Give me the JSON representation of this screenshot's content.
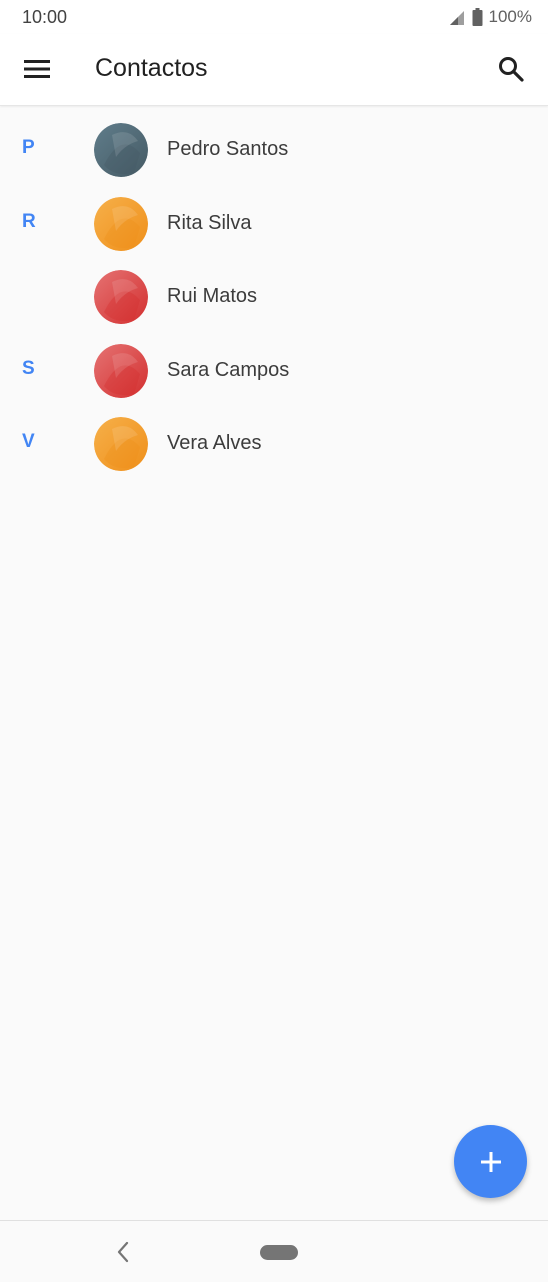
{
  "status_bar": {
    "time": "10:00",
    "battery": "100%",
    "icons": [
      "signal-icon",
      "battery-icon"
    ]
  },
  "app_bar": {
    "title": "Contactos",
    "menu_icon": "menu-icon",
    "search_icon": "search-icon"
  },
  "contacts": [
    {
      "letter": "P",
      "name": "Pedro Santos",
      "avatar_color": "#455a64",
      "avatar_color_light": "#607d8b"
    },
    {
      "letter": "R",
      "name": "Rita Silva",
      "avatar_color": "#ef8f1a",
      "avatar_color_light": "#f6b04a"
    },
    {
      "letter": "",
      "name": "Rui Matos",
      "avatar_color": "#d32f2f",
      "avatar_color_light": "#e57373"
    },
    {
      "letter": "S",
      "name": "Sara Campos",
      "avatar_color": "#d32f2f",
      "avatar_color_light": "#e57373"
    },
    {
      "letter": "V",
      "name": "Vera Alves",
      "avatar_color": "#ef8f1a",
      "avatar_color_light": "#f6b04a"
    }
  ],
  "fab": {
    "icon": "plus-icon",
    "color": "#4285f4"
  },
  "nav_bar": {
    "back_icon": "back-chevron-icon",
    "home_icon": "home-pill-icon"
  },
  "colors": {
    "accent": "#4285f4",
    "background": "#fafafa"
  }
}
